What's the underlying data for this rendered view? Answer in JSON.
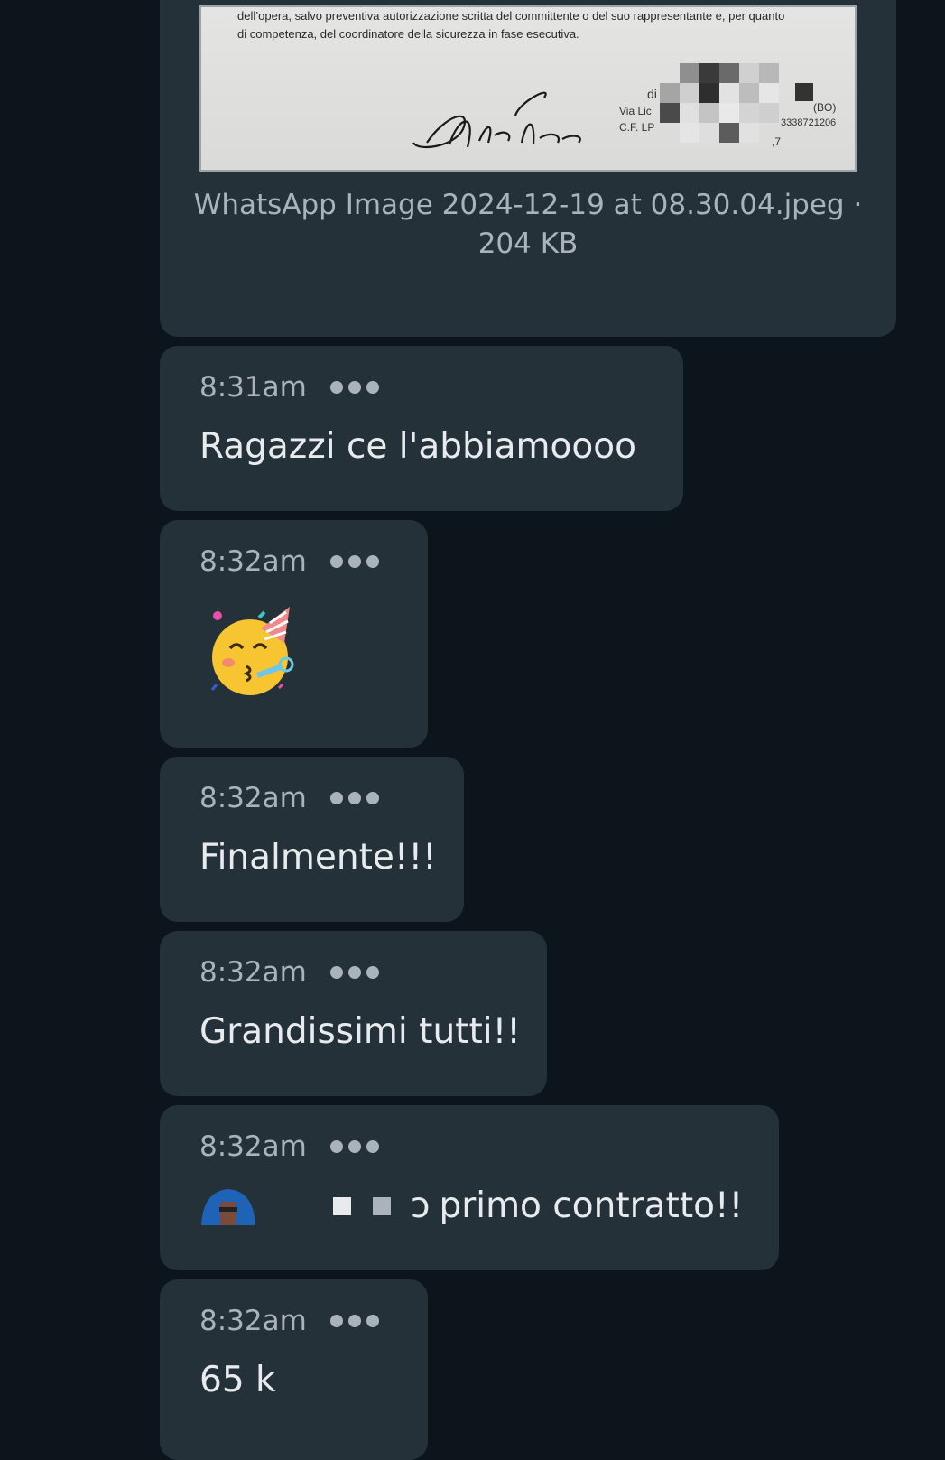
{
  "attachment": {
    "document_lines": [
      "dell’opera, salvo preventiva autorizzazione scritta del committente o del suo rappresentante e, per quanto",
      "di competenza, del coordinatore della sicurezza in fase esecutiva."
    ],
    "stamp": {
      "line1": "di",
      "line2": "Via Lic",
      "line3": "C.F. LP",
      "right1": "(BO)",
      "right2": "3338721206",
      "right3": ",7"
    },
    "filename_line": "WhatsApp Image 2024-12-19 at 08.30.04.jpeg ·",
    "filesize": "204 KB"
  },
  "messages": [
    {
      "time": "8:31am",
      "text": "Ragazzi ce l'abbiamoooo"
    },
    {
      "time": "8:32am",
      "emoji": "🥳"
    },
    {
      "time": "8:32am",
      "text": "Finalmente!!!"
    },
    {
      "time": "8:32am",
      "text": "Grandissimi tutti!!"
    },
    {
      "time": "8:32am",
      "text_visible": "primo contratto!!",
      "text_prefix_fragment": "ɔ"
    },
    {
      "time": "8:32am",
      "text": "65 k"
    }
  ],
  "colors": {
    "background": "#0c141c",
    "bubble": "#253139",
    "meta_text": "#aab3b9",
    "message_text": "#e8ebee"
  },
  "icons": {
    "menu": "more-horizontal-dots-icon",
    "emoji": "partying-face-emoji",
    "avatar": "person-hood-avatar"
  }
}
